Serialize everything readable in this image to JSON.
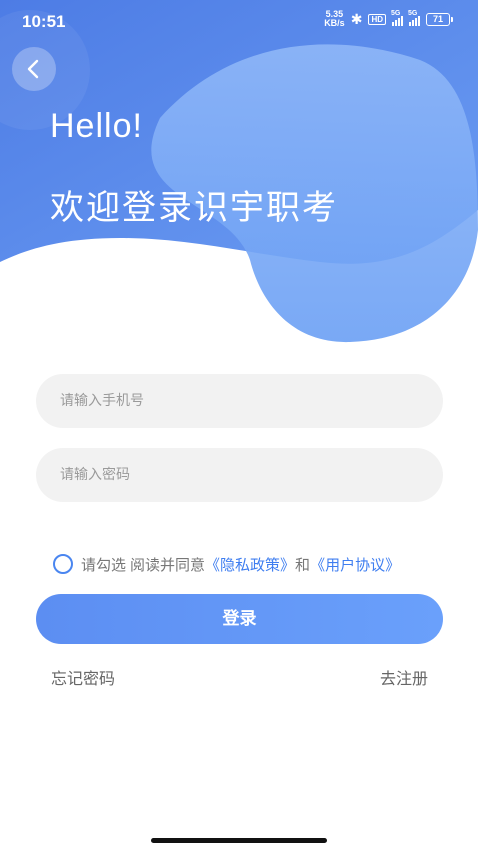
{
  "status_bar": {
    "time": "10:51",
    "net_speed_value": "5.35",
    "net_speed_unit": "KB/s",
    "hd": "HD",
    "signal_label": "5G",
    "battery": "71"
  },
  "header": {
    "greeting": "Hello!",
    "welcome": "欢迎登录识宇职考"
  },
  "form": {
    "phone_placeholder": "请输入手机号",
    "password_placeholder": "请输入密码"
  },
  "agreement": {
    "prefix": "请勾选",
    "read_agree": "阅读并同意",
    "privacy_link": "《隐私政策》",
    "and": "和",
    "user_agreement_link": "《用户协议》"
  },
  "actions": {
    "login": "登录",
    "forgot_password": "忘记密码",
    "register": "去注册"
  },
  "colors": {
    "primary": "#5c8ef2",
    "link": "#3f7ef0",
    "hero_dark": "#4f7fe6",
    "hero_light": "#6ea1f5"
  }
}
